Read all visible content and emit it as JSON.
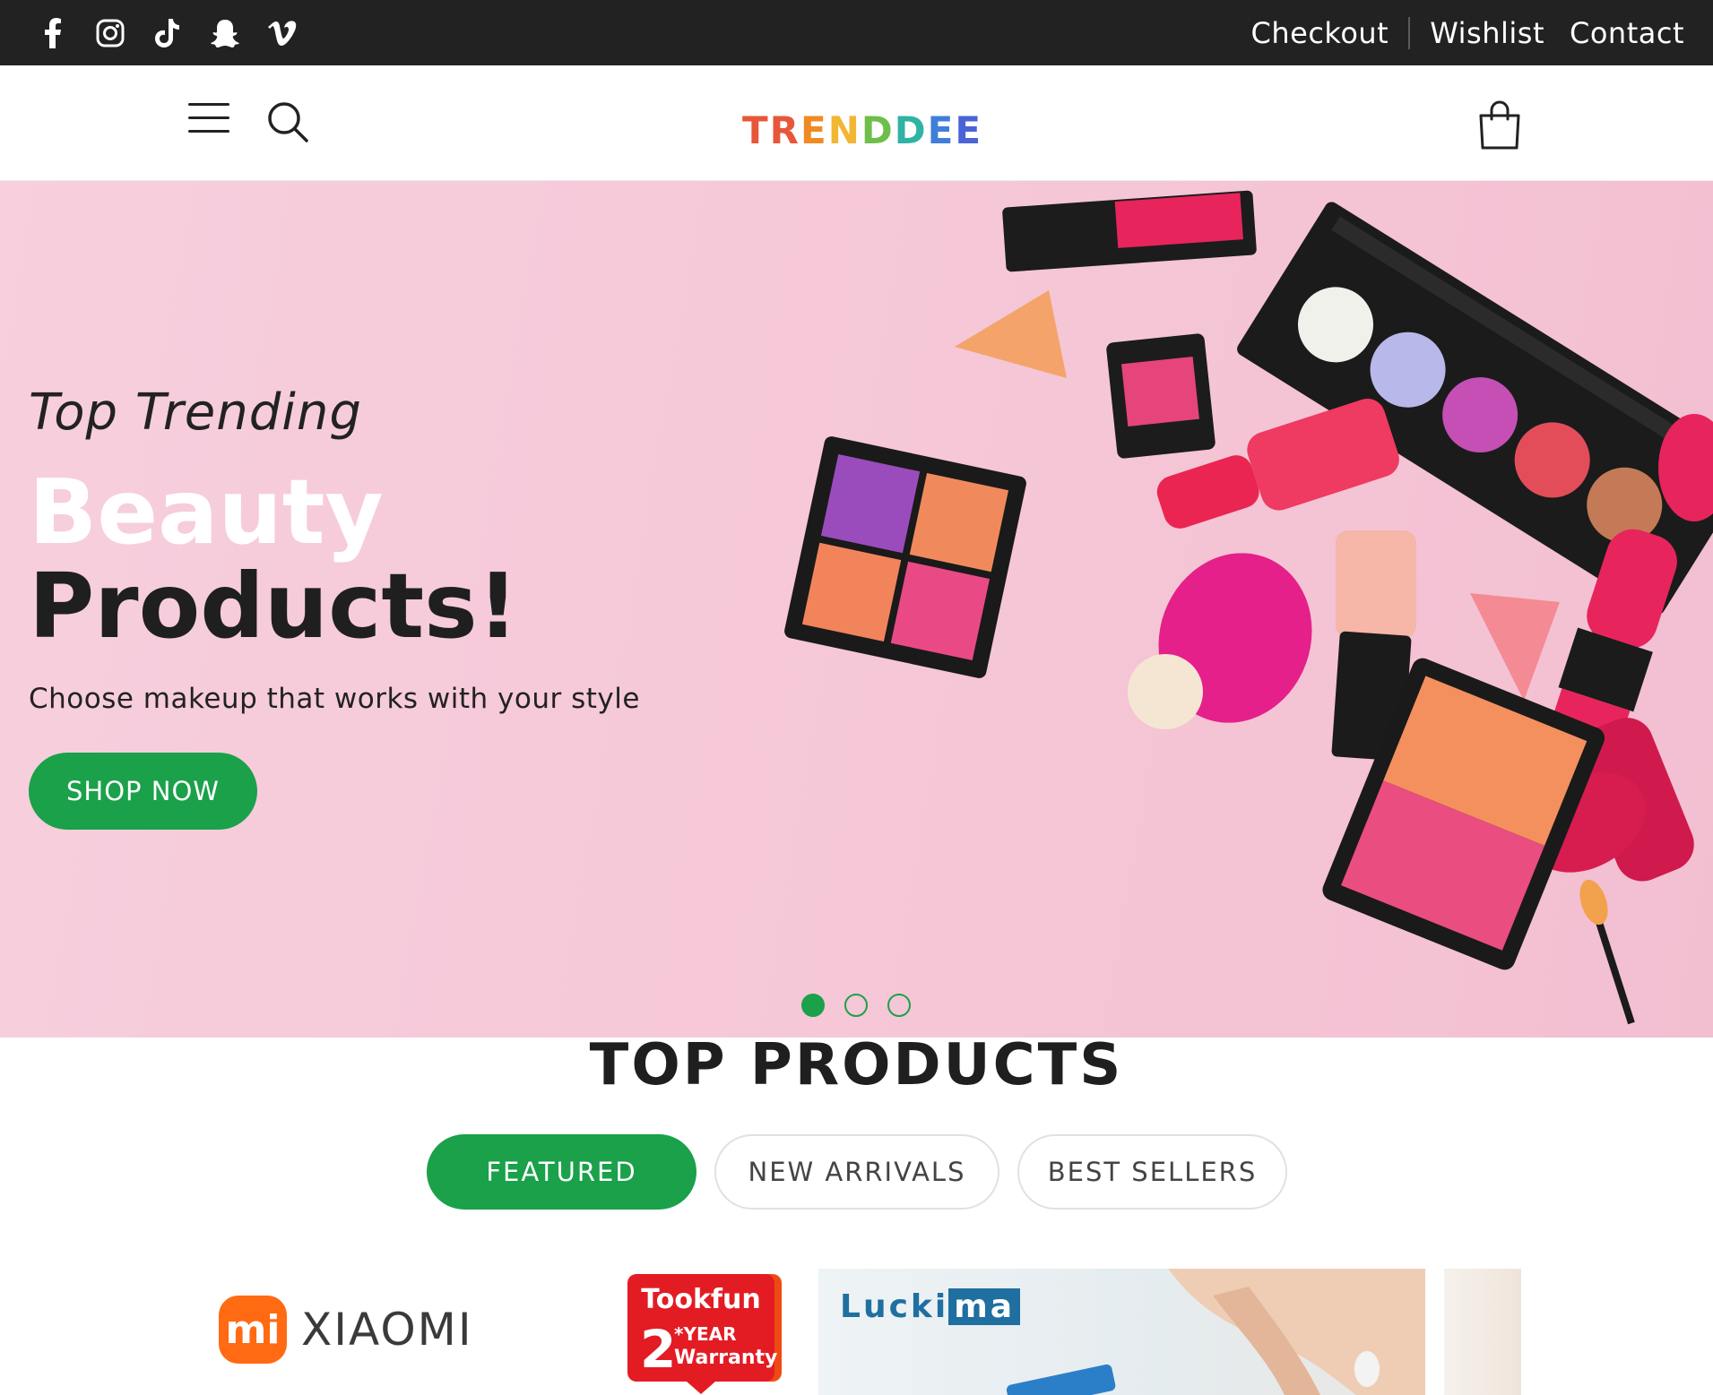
{
  "topbar": {
    "social_icons": [
      "facebook-icon",
      "instagram-icon",
      "tiktok-icon",
      "snapchat-icon",
      "vimeo-icon"
    ],
    "links": {
      "checkout": "Checkout",
      "wishlist": "Wishlist",
      "contact": "Contact"
    }
  },
  "header": {
    "logo_letters": [
      "T",
      "R",
      "E",
      "N",
      "D",
      "D",
      "E",
      "E"
    ],
    "logo_colors": [
      "#e8563a",
      "#e8563a",
      "#f08a24",
      "#f2b632",
      "#6cbf4b",
      "#2fb3a4",
      "#3f7fd8",
      "#4a63d6"
    ]
  },
  "hero": {
    "subtitle": "Top Trending",
    "title_line1": "Beauty",
    "title_line2": "Products!",
    "description": "Choose makeup that works with your style",
    "cta_label": "SHOP NOW",
    "slide_count": 3,
    "active_slide": 1
  },
  "products": {
    "section_title": "TOP PRODUCTS",
    "tabs": [
      {
        "label": "FEATURED",
        "active": true
      },
      {
        "label": "NEW ARRIVALS",
        "active": false
      },
      {
        "label": "BEST SELLERS",
        "active": false
      }
    ]
  },
  "brands": {
    "xiaomi": {
      "mark": "mi",
      "name": "XIAOMI"
    },
    "tookfun": {
      "name": "Tookfun",
      "badge_number": "2",
      "badge_text1": "*YEAR",
      "badge_text2": "Warranty"
    },
    "luckima": {
      "part1": "Lucki",
      "part2": "ma"
    }
  },
  "colors": {
    "accent": "#1aa14a",
    "topbar": "#222222",
    "hero_bg": "#f5c6d6"
  }
}
